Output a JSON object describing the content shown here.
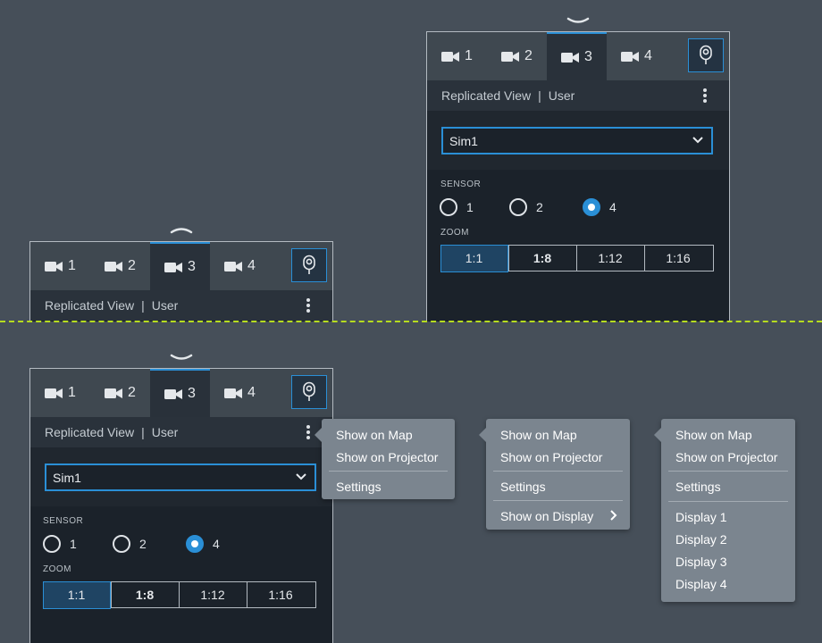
{
  "tabs": [
    {
      "label": "1",
      "icon": "video-camera-icon"
    },
    {
      "label": "2",
      "icon": "video-camera-icon"
    },
    {
      "label": "3",
      "icon": "video-camera-icon"
    },
    {
      "label": "4",
      "icon": "video-camera-icon"
    }
  ],
  "active_tab": "3",
  "probe_button_icon": "probe-icon",
  "subhead": {
    "left": "Replicated View",
    "separator": "|",
    "right": "User"
  },
  "select_value": "Sim1",
  "sensor": {
    "label": "SENSOR",
    "options": [
      "1",
      "2",
      "4"
    ],
    "selected": "4"
  },
  "zoom": {
    "label": "ZOOM",
    "options": [
      "1:1",
      "1:8",
      "1:12",
      "1:16"
    ],
    "selected": "1:1"
  },
  "menu_a": {
    "items": [
      "Show on Map",
      "Show on Projector",
      "Settings"
    ]
  },
  "menu_b": {
    "items": [
      "Show on Map",
      "Show on Projector",
      "Settings",
      "Show on Display"
    ]
  },
  "menu_c": {
    "items": [
      "Show on Map",
      "Show on Projector",
      "Settings"
    ],
    "displays": [
      "Display 1",
      "Display 2",
      "Display 3",
      "Display 4"
    ]
  },
  "colors": {
    "accent": "#2a8fd6",
    "guide_line": "#b6dc1f",
    "background": "#464f59",
    "menu_bg": "#7b858f"
  }
}
